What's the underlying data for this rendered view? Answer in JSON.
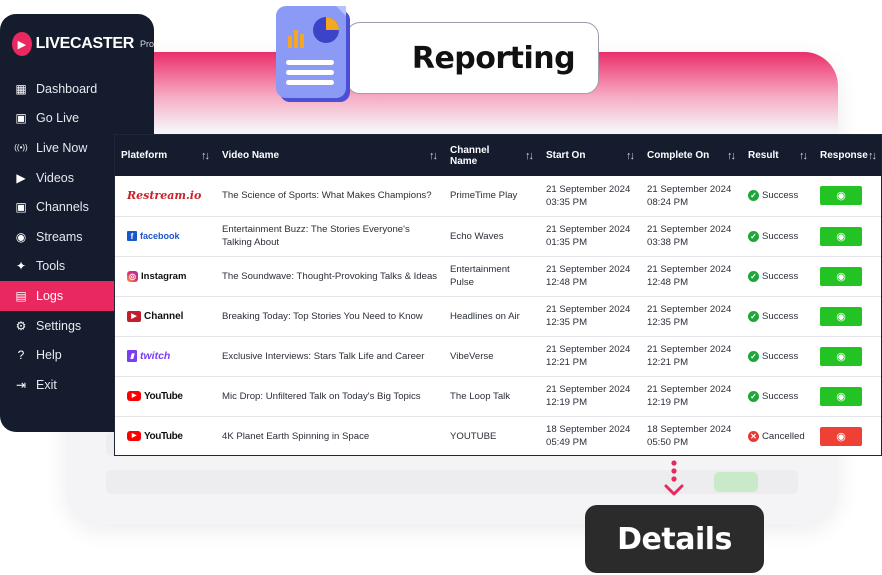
{
  "app": {
    "brand": "LIVECASTER",
    "brand_suffix": "Pro"
  },
  "sidebar": {
    "items": [
      {
        "label": "Dashboard",
        "icon": "grid-icon",
        "glyph": "▦",
        "active": false
      },
      {
        "label": "Go Live",
        "icon": "live-icon",
        "glyph": "▣",
        "active": false
      },
      {
        "label": "Live Now",
        "icon": "broadcast-icon",
        "glyph": "((•))",
        "active": false
      },
      {
        "label": "Videos",
        "icon": "video-icon",
        "glyph": "▶",
        "active": false
      },
      {
        "label": "Channels",
        "icon": "channel-icon",
        "glyph": "▣",
        "active": false
      },
      {
        "label": "Streams",
        "icon": "stream-icon",
        "glyph": "◉",
        "active": false
      },
      {
        "label": "Tools",
        "icon": "tools-icon",
        "glyph": "✦",
        "active": false
      },
      {
        "label": "Logs",
        "icon": "logs-icon",
        "glyph": "▤",
        "active": true
      },
      {
        "label": "Settings",
        "icon": "gear-icon",
        "glyph": "⚙",
        "active": false
      },
      {
        "label": "Help",
        "icon": "help-icon",
        "glyph": "?",
        "active": false
      },
      {
        "label": "Exit",
        "icon": "exit-icon",
        "glyph": "⇥",
        "active": false
      }
    ]
  },
  "callouts": {
    "reporting": "Reporting",
    "details": "Details"
  },
  "table": {
    "columns": [
      {
        "label": "Plateform",
        "sortable": true
      },
      {
        "label": "Video Name",
        "sortable": true
      },
      {
        "label": "Channel Name",
        "sortable": true
      },
      {
        "label": "Start On",
        "sortable": true
      },
      {
        "label": "Complete On",
        "sortable": true
      },
      {
        "label": "Result",
        "sortable": true
      },
      {
        "label": "Response",
        "sortable": true
      }
    ],
    "rows": [
      {
        "platform": "Restream.io",
        "platform_key": "restream",
        "video": "The Science of Sports: What Makes Champions?",
        "channel": "PrimeTime Play",
        "start": "21 September 2024 03:35 PM",
        "complete": "21 September 2024 08:24 PM",
        "result": "Success",
        "status": "ok"
      },
      {
        "platform": "facebook",
        "platform_key": "facebook",
        "video": "Entertainment Buzz: The Stories Everyone's Talking About",
        "channel": "Echo Waves",
        "start": "21 September 2024 01:35 PM",
        "complete": "21 September 2024 03:38 PM",
        "result": "Success",
        "status": "ok"
      },
      {
        "platform": "Instagram",
        "platform_key": "insta",
        "video": "The Soundwave: Thought-Provoking Talks & Ideas",
        "channel": "Entertainment Pulse",
        "start": "21 September 2024 12:48 PM",
        "complete": "21 September 2024 12:48 PM",
        "result": "Success",
        "status": "ok"
      },
      {
        "platform": "Channel",
        "platform_key": "channel",
        "video": "Breaking Today: Top Stories You Need to Know",
        "channel": "Headlines on Air",
        "start": "21 September 2024 12:35 PM",
        "complete": "21 September 2024 12:35 PM",
        "result": "Success",
        "status": "ok"
      },
      {
        "platform": "twitch",
        "platform_key": "twitch",
        "video": "Exclusive Interviews: Stars Talk Life and Career",
        "channel": "VibeVerse",
        "start": "21 September 2024 12:21 PM",
        "complete": "21 September 2024 12:21 PM",
        "result": "Success",
        "status": "ok"
      },
      {
        "platform": "YouTube",
        "platform_key": "yt",
        "video": "Mic Drop: Unfiltered Talk on Today's Big Topics",
        "channel": "The Loop Talk",
        "start": "21 September 2024 12:19 PM",
        "complete": "21 September 2024 12:19 PM",
        "result": "Success",
        "status": "ok"
      },
      {
        "platform": "YouTube",
        "platform_key": "yt",
        "video": "4K Planet Earth Spinning in Space",
        "channel": "YOUTUBE",
        "start": "18 September 2024 05:49 PM",
        "complete": "18 September 2024 05:50 PM",
        "result": "Cancelled",
        "status": "bad"
      }
    ]
  },
  "colors": {
    "sidebar_bg": "#141c2e",
    "accent": "#e8285f",
    "success": "#22c322",
    "cancel": "#ef4036"
  }
}
